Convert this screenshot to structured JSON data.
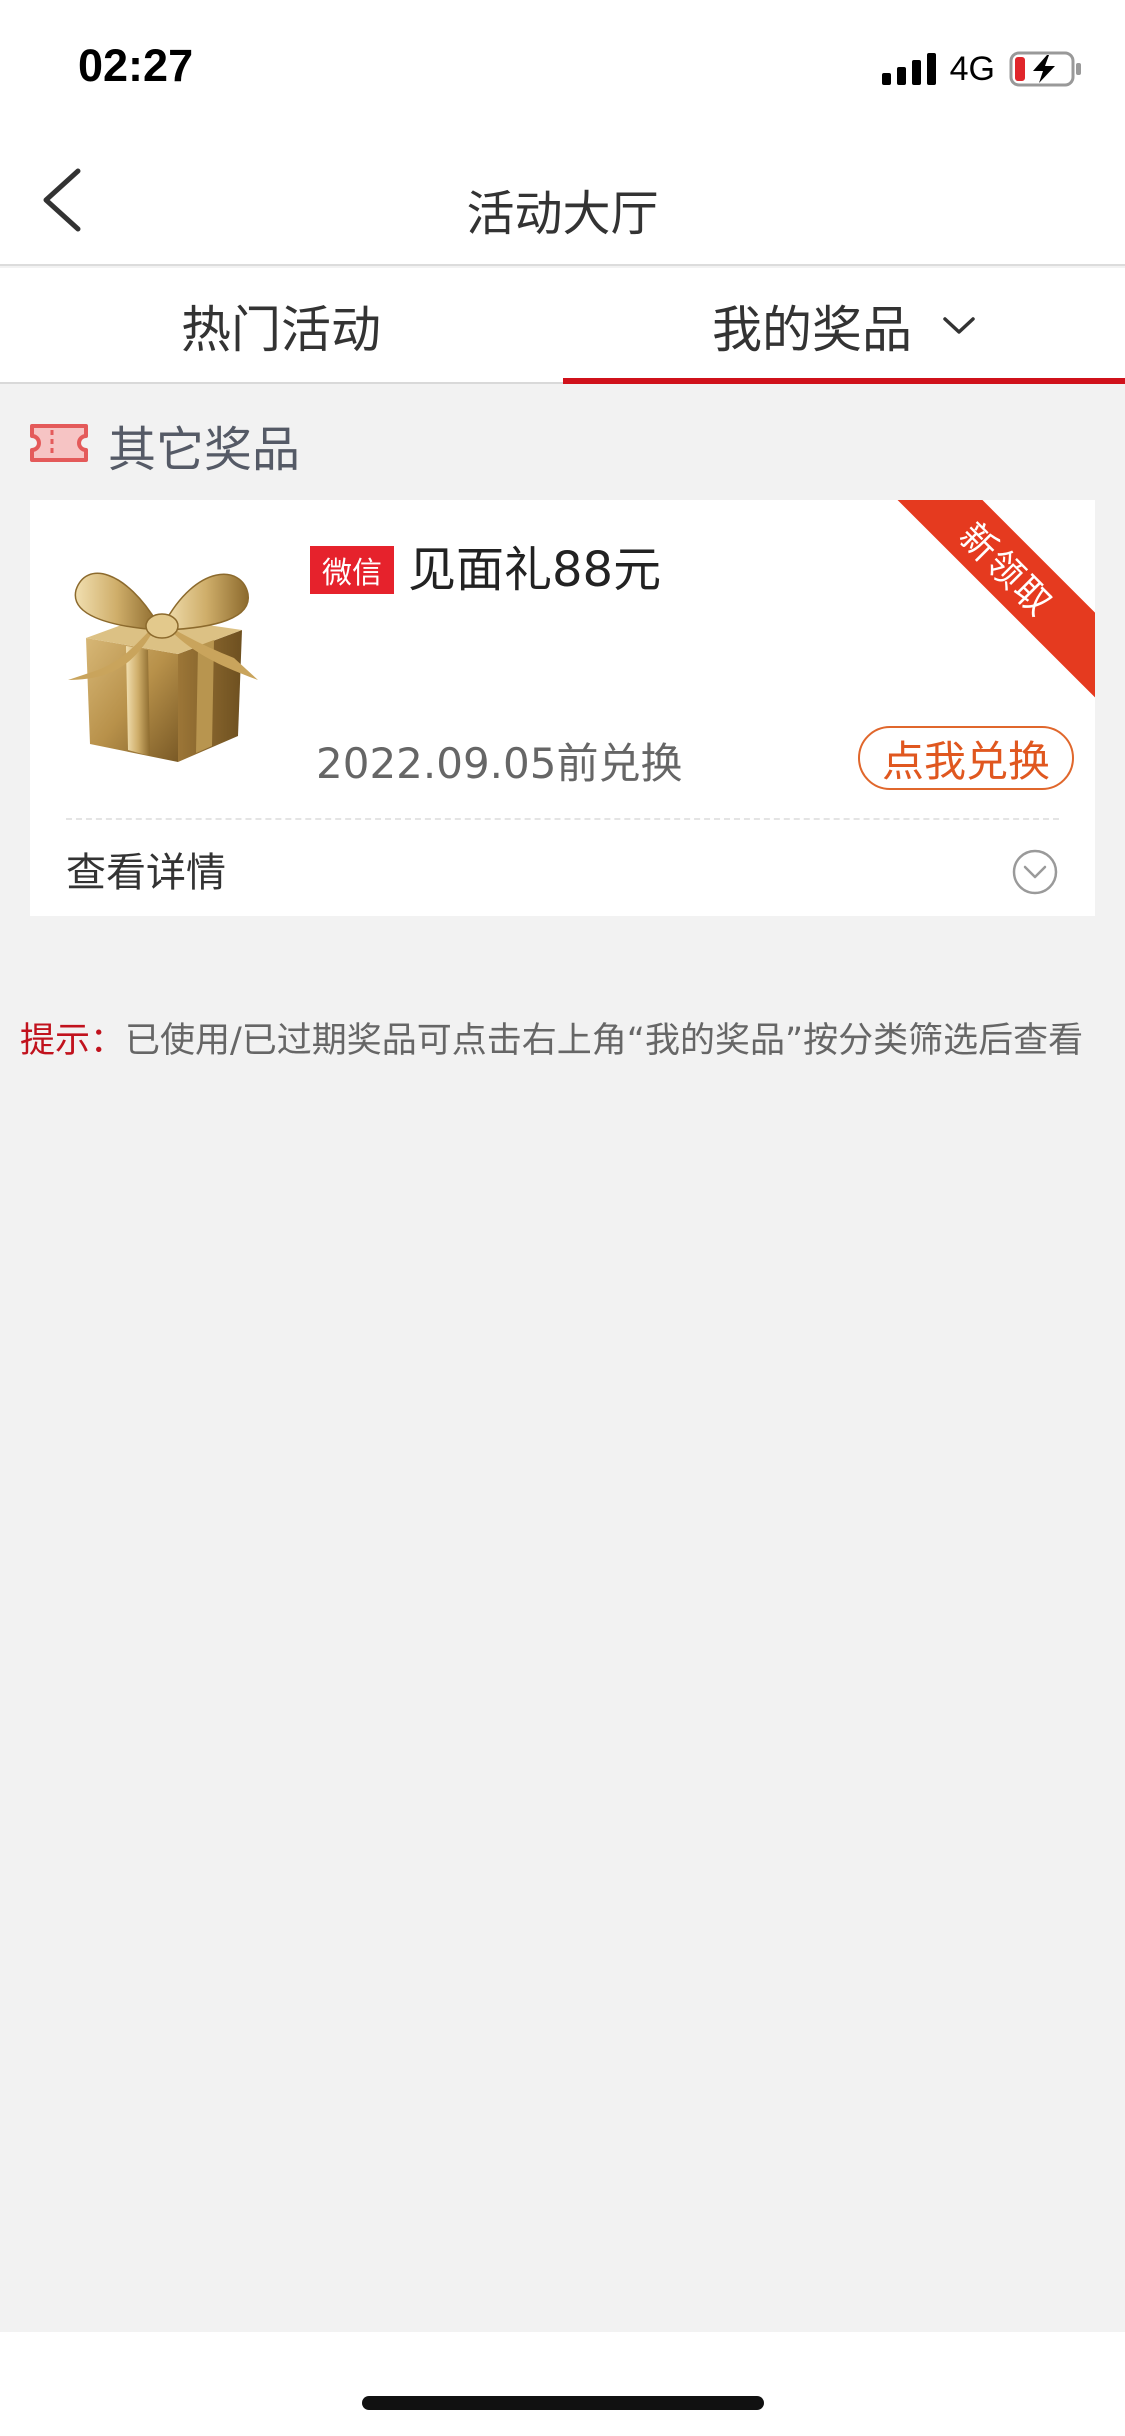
{
  "status_bar": {
    "time": "02:27",
    "network": "4G",
    "battery_color": "#e0262b"
  },
  "header": {
    "title": "活动大厅",
    "back_icon": "back-arrow-icon"
  },
  "tabs": [
    {
      "label": "热门活动",
      "active": false
    },
    {
      "label": "我的奖品",
      "active": true,
      "icon": "chevron-down-icon"
    }
  ],
  "section": {
    "title": "其它奖品",
    "icon": "ticket-icon"
  },
  "prize_card": {
    "platform": "微信",
    "name": "见面礼88元",
    "expire": "2022.09.05前兑换",
    "redeem_label": "点我兑换",
    "ribbon": "新领取",
    "details_label": "查看详情",
    "image": "gift-box-icon"
  },
  "tip": {
    "label": "提示：",
    "text": "已使用/已过期奖品可点击右上角“我的奖品”按分类筛选后查看"
  },
  "colors": {
    "accent": "#d0111b",
    "redeem": "#e0571f",
    "badge": "#e6222c",
    "background": "#f2f2f2"
  }
}
